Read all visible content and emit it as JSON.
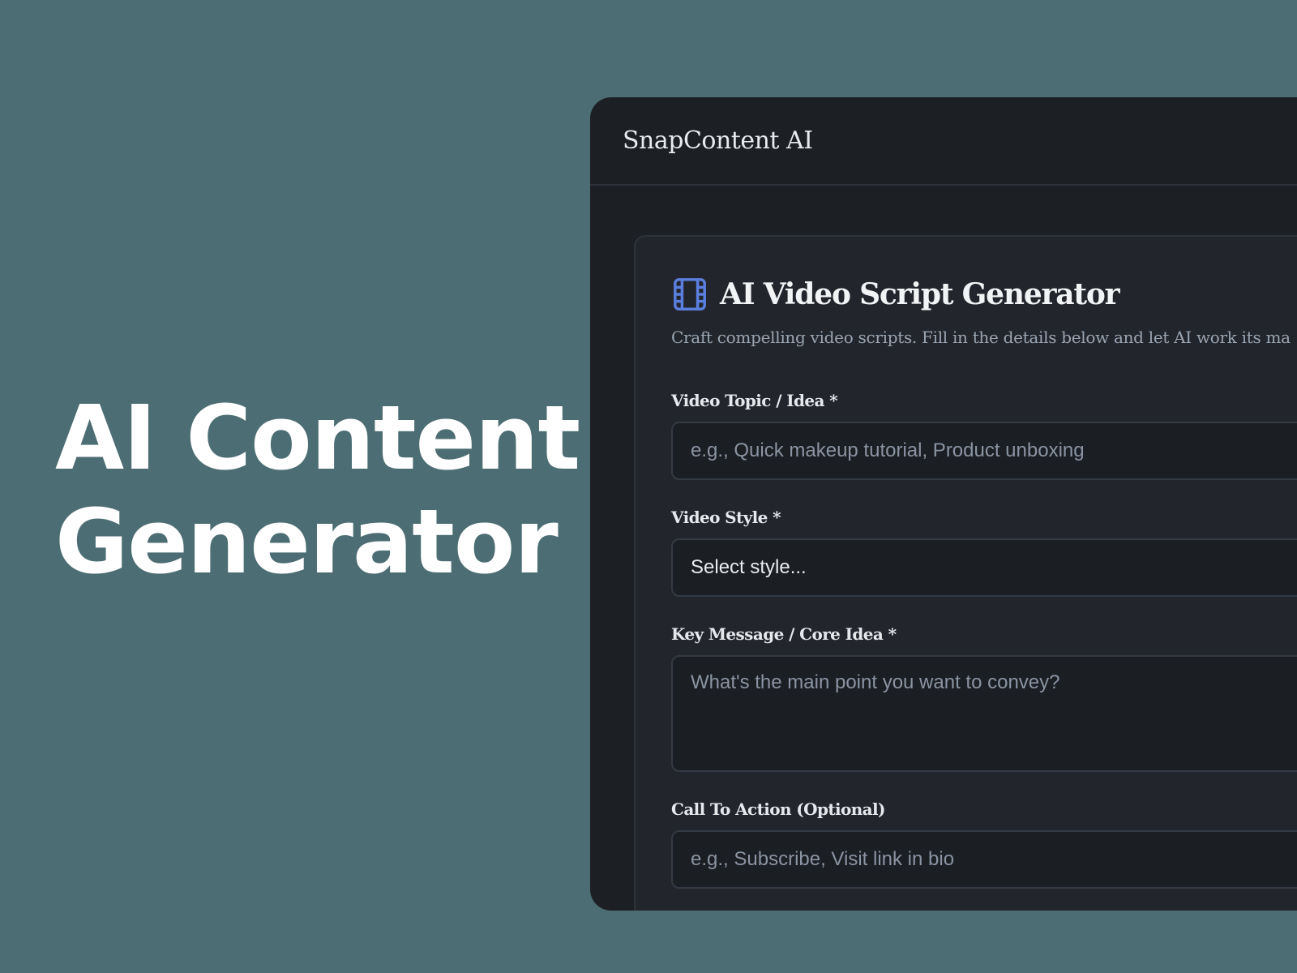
{
  "hero": {
    "line1": "AI Content",
    "line2": "Generator"
  },
  "app": {
    "brand": "SnapContent AI"
  },
  "card": {
    "icon": "film-icon",
    "title": "AI Video Script Generator",
    "subtitle": "Craft compelling video scripts. Fill in the details below and let AI work its ma"
  },
  "form": {
    "topic": {
      "label": "Video Topic / Idea *",
      "placeholder": "e.g., Quick makeup tutorial, Product unboxing"
    },
    "style": {
      "label": "Video Style *",
      "selected": "Select style..."
    },
    "message": {
      "label": "Key Message / Core Idea *",
      "placeholder": "What's the main point you want to convey?"
    },
    "cta": {
      "label": "Call To Action (Optional)",
      "placeholder": "e.g., Subscribe, Visit link in bio"
    }
  },
  "colors": {
    "background": "#4c6d73",
    "window": "#1c1f24",
    "card": "#22262c",
    "accent_icon": "#5b7fe0"
  }
}
